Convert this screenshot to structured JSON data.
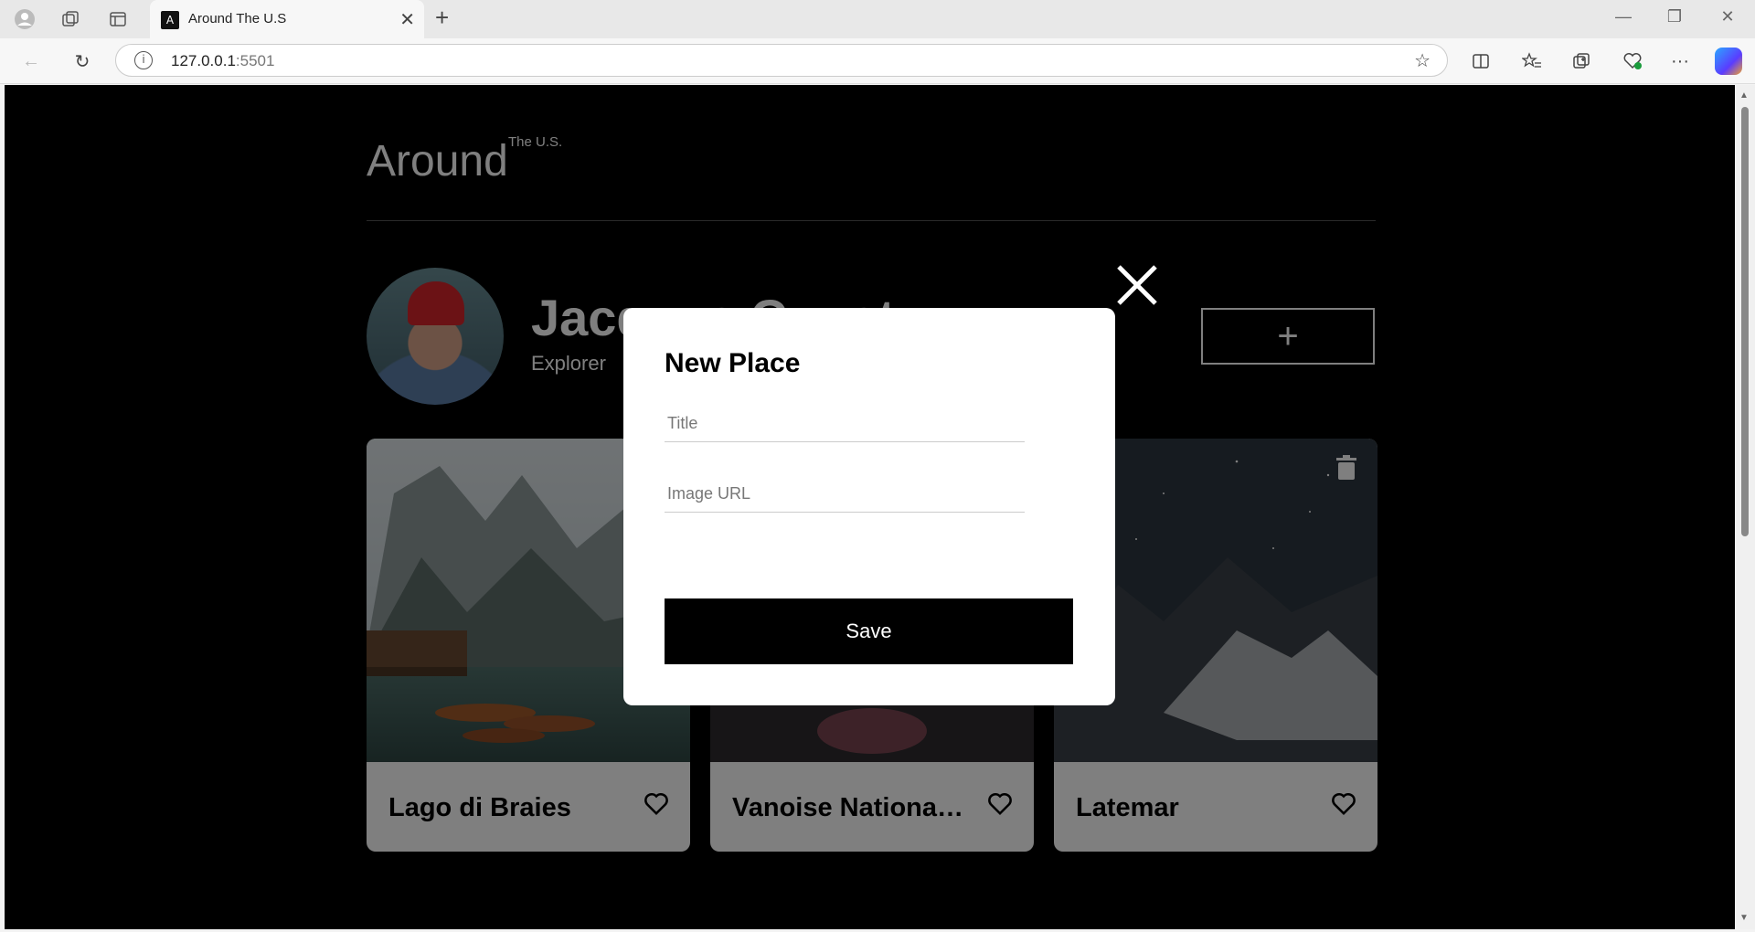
{
  "browser": {
    "tab_title": "Around The U.S",
    "tab_favicon": "A",
    "url_host": "127.0.0.1",
    "url_port": ":5501"
  },
  "site": {
    "logo": "Around",
    "logo_sup": "The U.S."
  },
  "profile": {
    "name": "Jacques Cousteau",
    "job": "Explorer"
  },
  "cards": [
    {
      "title": "Lago di Braies"
    },
    {
      "title": "Vanoise National Park"
    },
    {
      "title": "Latemar"
    }
  ],
  "modal": {
    "title": "New Place",
    "title_placeholder": "Title",
    "url_placeholder": "Image URL",
    "save_label": "Save"
  },
  "colors": {
    "overlay": "rgba(0,0,0,0.5)",
    "button": "#000000"
  }
}
